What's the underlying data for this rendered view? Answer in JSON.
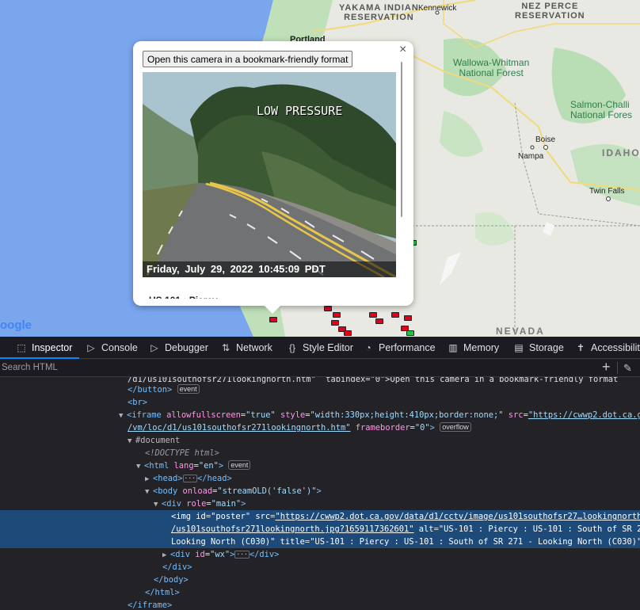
{
  "map": {
    "labels": {
      "yakama": "YAKAMA INDIAN\nRESERVATION",
      "kennewick": "Kennewick",
      "nez_perce": "NEZ PERCE\nRESERVATION",
      "portland": "Portland",
      "wallowa": "Wallowa-Whitman\nNational Forest",
      "salmon": "Salmon-Challi\nNational Fores",
      "boise": "Boise",
      "nampa": "Nampa",
      "idaho": "IDAHO",
      "twin_falls": "Twin Falls",
      "nevada": "NEVADA"
    },
    "google_logo": "oogle"
  },
  "popup": {
    "bookmark_button": "Open this camera in a bookmark-friendly format",
    "close_glyph": "×",
    "overlay_text": "LOW PRESSURE",
    "timestamp": "Friday,  July  29,  2022    10:45:09 PDT",
    "caption": "US 101 : Piercy"
  },
  "devtools": {
    "tabs": [
      {
        "label": "Inspector",
        "icon": "inspector-icon",
        "glyph": "⬚"
      },
      {
        "label": "Console",
        "icon": "console-icon",
        "glyph": "▷"
      },
      {
        "label": "Debugger",
        "icon": "debugger-icon",
        "glyph": "▷"
      },
      {
        "label": "Network",
        "icon": "network-icon",
        "glyph": "⇅"
      },
      {
        "label": "Style Editor",
        "icon": "style-editor-icon",
        "glyph": "{}"
      },
      {
        "label": "Performance",
        "icon": "performance-icon",
        "glyph": "◔"
      },
      {
        "label": "Memory",
        "icon": "memory-icon",
        "glyph": "▥"
      },
      {
        "label": "Storage",
        "icon": "storage-icon",
        "glyph": "▤"
      },
      {
        "label": "Accessibilit",
        "icon": "accessibility-icon",
        "glyph": "✝"
      }
    ],
    "search_placeholder": "Search HTML",
    "tree": {
      "r0": "/d1/us101southofsr271lookingnorth.htm\"  tabindex=\"0\">Open this camera in a bookmark-friendly format",
      "r1_tag": "</button>",
      "r1_badge": "event",
      "r2_tag": "<br>",
      "r3_open": "<iframe",
      "r3_a1": "allowfullscreen",
      "r3_v1": "\"true\"",
      "r3_a2": "style",
      "r3_v2": "\"width:330px;height:410px;border:none;\"",
      "r3_a3": "src",
      "r3_v3": "\"https://cwwp2.dot.ca.gov",
      "r4_v3": "/vm/loc/d1/us101southofsr271lookingnorth.htm\"",
      "r4_a4": "frameborder",
      "r4_v4": "\"0\"",
      "r4_close": ">",
      "r4_badge": "overflow",
      "r5": "#document",
      "r6": "<!DOCTYPE html>",
      "r7_open": "<html",
      "r7_a": "lang",
      "r7_v": "\"en\"",
      "r7_close": ">",
      "r7_badge": "event",
      "r8_open": "<head>",
      "r8_dots": "···",
      "r8_close": "</head>",
      "r9_open": "<body",
      "r9_a": "onload",
      "r9_v": "\"streamOLD('false')\"",
      "r9_close": ">",
      "r10_open": "<div",
      "r10_a": "role",
      "r10_v": "\"main\"",
      "r10_close": ">",
      "r11_open": "<img",
      "r11_a1": "id",
      "r11_v1": "\"poster\"",
      "r11_a2": "src",
      "r11_v2": "\"https://cwwp2.dot.ca.gov/data/d1/cctv/image/us101southofsr27…lookingnorth",
      "r12_v2": "/us101southofsr271lookingnorth.jpg?1659117362601\"",
      "r12_a3": "alt",
      "r12_v3": "\"US-101 : Piercy : US-101 : South of SR 271 -",
      "r13_v3": "Looking North (C030)\"",
      "r13_a4": "title",
      "r13_v4": "\"US-101 : Piercy : US-101 : South of SR 271 - Looking North (C030)\"",
      "r13_close": ">",
      "r14_open": "<div",
      "r14_a": "id",
      "r14_v": "\"wx\"",
      "r14_close": ">",
      "r14_dots": "···",
      "r14_end": "</div>",
      "r15": "</div>",
      "r16": "</body>",
      "r17": "</html>",
      "r18": "</iframe>"
    }
  }
}
